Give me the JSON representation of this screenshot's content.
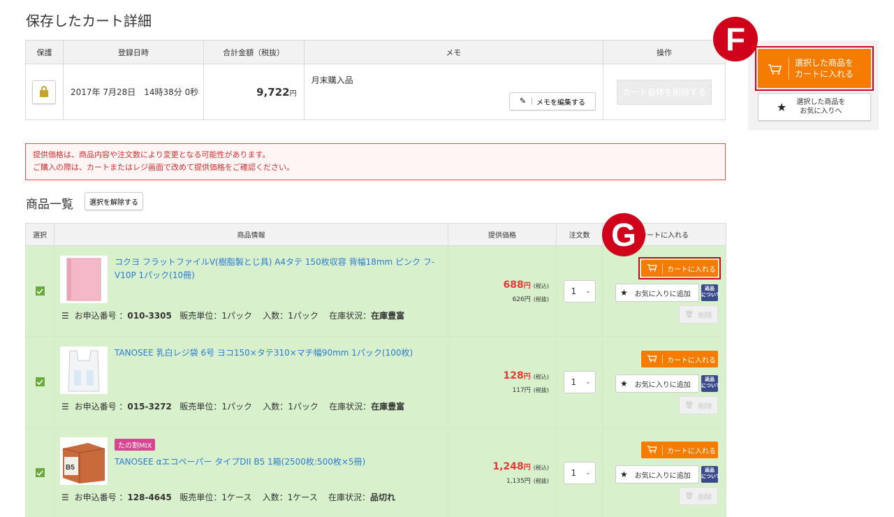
{
  "page": {
    "title": "保存したカート詳細"
  },
  "saved_cart": {
    "headers": [
      "保護",
      "登録日時",
      "合計金額（税抜）",
      "メモ",
      "操作"
    ],
    "date": "2017年 7月28日　14時38分 0秒",
    "total": "9,722",
    "yen": "円",
    "memo": "月末購入品",
    "memo_edit_label": "メモを編集する",
    "delete_cart_label": "カート自体を削除する"
  },
  "side": {
    "cart_label": "選択した商品を\nカートに入れる",
    "fav_label": "選択した商品を\nお気に入りへ",
    "badge_f": "F",
    "badge_g": "G"
  },
  "notice": {
    "line1": "提供価格は、商品内容や注文数により変更となる可能性があります。",
    "line2": "ご購入の際は、カートまたはレジ画面で改めて提供価格をご確認ください。"
  },
  "product_list": {
    "title": "商品一覧",
    "deselect_label": "選択を解除する",
    "headers": [
      "選択",
      "商品情報",
      "提供価格",
      "注文数",
      "カートに入れる"
    ],
    "meta_labels": {
      "order_no": "お申込番号 ：",
      "unit": "販売単位：",
      "count": "入数：",
      "stock": "在庫状況："
    },
    "tax_in": "(税込)",
    "tax_out": "(税抜)",
    "cart_btn": "カートに入れる",
    "fav_btn": "お気に入りに追加",
    "return_badge": "返品\nについて",
    "delete_btn": "削除",
    "items": [
      {
        "name": "コクヨ フラットファイルV(樹脂製とじ具) A4タテ 150枚収容 背幅18mm ピンク フ-V10P 1パック(10冊)",
        "order_no": "010-3305",
        "unit": "1パック",
        "count": "1パック",
        "stock": "在庫豊富",
        "price_main": "688",
        "price_sub": "626円",
        "qty": "1"
      },
      {
        "name": "TANOSEE 乳白レジ袋 6号 ヨコ150×タテ310×マチ幅90mm 1パック(100枚)",
        "order_no": "015-3272",
        "unit": "1パック",
        "count": "1パック",
        "stock": "在庫豊富",
        "price_main": "128",
        "price_sub": "117円",
        "qty": "1"
      },
      {
        "tag": "たの割MIX",
        "name": "TANOSEE αエコペーパー タイプDII B5 1箱(2500枚:500枚×5冊)",
        "order_no": "128-4645",
        "unit": "1ケース",
        "count": "1ケース",
        "stock": "品切れ",
        "price_main": "1,248",
        "price_sub": "1,135円",
        "qty": "1"
      }
    ]
  },
  "colors": {
    "accent": "#f57c00",
    "highlight": "#d0021b",
    "row_bg": "#d8f0cc",
    "link": "#2a7bd6",
    "price": "#e53935"
  }
}
